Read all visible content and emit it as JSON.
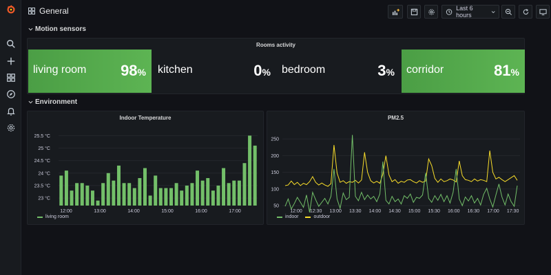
{
  "header": {
    "title": "General",
    "time_range": "Last 6 hours"
  },
  "sidemenu": {
    "icons": [
      "grafana-logo-icon",
      "search-icon",
      "plus-icon",
      "dashboards-icon",
      "explore-compass-icon",
      "alerting-bell-icon",
      "settings-gear-icon"
    ]
  },
  "rows": {
    "motion": "Motion sensors",
    "environment": "Environment"
  },
  "rooms_panel": {
    "title": "Rooms activity",
    "stats": [
      {
        "name": "living room",
        "value": "98",
        "unit": "%",
        "highlight": true
      },
      {
        "name": "kitchen",
        "value": "0",
        "unit": "%",
        "highlight": false
      },
      {
        "name": "bedroom",
        "value": "3",
        "unit": "%",
        "highlight": false
      },
      {
        "name": "corridor",
        "value": "81",
        "unit": "%",
        "highlight": true
      }
    ]
  },
  "colors": {
    "green": "#73bf69",
    "yellow": "#fade2a",
    "stat_green": "#56a64b"
  },
  "chart_data": [
    {
      "type": "bar",
      "title": "Indoor Temperature",
      "ylim": [
        22.7,
        25.7
      ],
      "yticks": [
        23,
        23.5,
        24,
        24.5,
        25,
        25.5
      ],
      "ytick_labels": [
        "23 °C",
        "23.5 °C",
        "24 °C",
        "24.5 °C",
        "25 °C",
        "25.5 °C"
      ],
      "xtick_labels": [
        "12:00",
        "13:00",
        "14:00",
        "15:00",
        "16:00",
        "17:00"
      ],
      "series": [
        {
          "name": "living room",
          "values": [
            23.9,
            24.1,
            23.3,
            23.6,
            23.6,
            23.5,
            23.3,
            22.9,
            23.6,
            24.0,
            23.7,
            24.3,
            23.6,
            23.6,
            23.4,
            23.8,
            24.2,
            23.1,
            23.9,
            23.4,
            23.4,
            23.4,
            23.6,
            23.3,
            23.5,
            23.6,
            24.1,
            23.7,
            23.8,
            23.3,
            23.5,
            24.2,
            23.6,
            23.7,
            23.7,
            24.4,
            25.5,
            25.1
          ]
        }
      ],
      "grid": true,
      "legend": "bottom-left"
    },
    {
      "type": "line",
      "title": "PM2.5",
      "ylim": [
        40,
        275
      ],
      "yticks": [
        50,
        100,
        150,
        200,
        250
      ],
      "xtick_labels": [
        "12:00",
        "12:30",
        "13:00",
        "13:30",
        "14:00",
        "14:30",
        "15:00",
        "15:30",
        "16:00",
        "16:30",
        "17:00",
        "17:30"
      ],
      "series": [
        {
          "name": "indoor",
          "values": [
            48,
            70,
            40,
            56,
            75,
            60,
            45,
            82,
            30,
            90,
            68,
            48,
            60,
            72,
            55,
            78,
            160,
            70,
            42,
            88,
            68,
            75,
            262,
            78,
            65,
            90,
            68,
            82,
            70,
            78,
            62,
            85,
            182,
            66,
            55,
            78,
            62,
            70,
            55,
            80,
            72,
            85,
            60,
            75,
            72,
            82,
            148,
            72,
            60,
            80,
            66,
            84,
            62,
            80,
            58,
            90,
            160,
            70,
            50,
            76,
            64,
            80,
            58,
            72,
            52,
            84,
            102,
            70,
            46,
            82,
            115,
            76,
            52,
            85,
            62,
            48,
            110
          ]
        },
        {
          "name": "outdoor",
          "values": [
            110,
            112,
            124,
            113,
            120,
            110,
            117,
            113,
            122,
            137,
            120,
            112,
            118,
            112,
            108,
            116,
            232,
            148,
            120,
            125,
            117,
            122,
            120,
            126,
            118,
            127,
            210,
            150,
            125,
            118,
            123,
            117,
            145,
            200,
            142,
            122,
            128,
            117,
            123,
            120,
            127,
            128,
            122,
            118,
            125,
            120,
            124,
            190,
            170,
            132,
            120,
            130,
            122,
            125,
            130,
            127,
            121,
            184,
            140,
            128,
            126,
            122,
            130,
            124,
            128,
            126,
            122,
            215,
            150,
            130,
            135,
            128,
            122,
            128,
            134,
            140,
            126
          ]
        }
      ],
      "grid": true,
      "legend": "bottom-left"
    }
  ]
}
